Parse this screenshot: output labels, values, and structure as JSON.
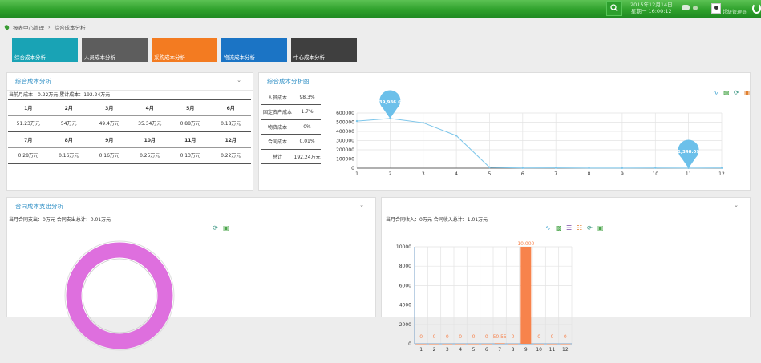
{
  "header": {
    "date": "2015年12月14日",
    "time": "星期一 16:00:12",
    "user": "超级管理员"
  },
  "breadcrumb": {
    "root": "报表中心管理",
    "current": "综合成本分析"
  },
  "tiles": [
    {
      "label": "综合成本分析",
      "color": "#19a3b5"
    },
    {
      "label": "人员成本分析",
      "color": "#5d5d5d"
    },
    {
      "label": "采购成本分析",
      "color": "#f37b21"
    },
    {
      "label": "物流成本分析",
      "color": "#1b74c5"
    },
    {
      "label": "中心成本分析",
      "color": "#3f3f3f"
    }
  ],
  "monthly": {
    "title": "综合成本分析",
    "summary": "当前月成本：0.22万元 累计成本：192.24万元",
    "row1_months": [
      "1月",
      "2月",
      "3月",
      "4月",
      "5月",
      "6月"
    ],
    "row1_values": [
      "51.23万元",
      "54万元",
      "49.4万元",
      "35.34万元",
      "0.88万元",
      "0.18万元"
    ],
    "row2_months": [
      "7月",
      "8月",
      "9月",
      "10月",
      "11月",
      "12月"
    ],
    "row2_values": [
      "0.28万元",
      "0.16万元",
      "0.16万元",
      "0.25万元",
      "0.13万元",
      "0.22万元"
    ]
  },
  "cost_chart": {
    "title": "综合成本分析图",
    "breakdown": [
      {
        "name": "人员成本",
        "pct": "98.3%"
      },
      {
        "name": "固定资产成本",
        "pct": "1.7%"
      },
      {
        "name": "物资成本",
        "pct": "0%"
      },
      {
        "name": "合同成本",
        "pct": "0.01%"
      },
      {
        "name": "总计",
        "pct": "192.24万元"
      }
    ]
  },
  "contract_expense": {
    "title": "合同成本支出分析",
    "summary": "当月合同支出：0万元 合同支出总计：0.01万元"
  },
  "contract_income": {
    "summary": "当月合同收入：0万元 合同收入总计：1.01万元"
  },
  "colors": {
    "line": "#7dc6ea",
    "bar": "#f7834c",
    "donut": "#de6fde",
    "accent": "#2c8ec4"
  },
  "chart_data": [
    {
      "type": "line",
      "x": [
        1,
        2,
        3,
        4,
        5,
        6,
        7,
        8,
        9,
        10,
        11,
        12
      ],
      "values": [
        512300,
        539986.64,
        494000,
        353400,
        8800,
        1800,
        2800,
        1600,
        1600,
        2500,
        1348.09,
        2200
      ],
      "ylim": [
        0,
        600000
      ],
      "yticks": [
        "600000",
        "500000",
        "400000",
        "300000",
        "200000",
        "100000",
        "0"
      ],
      "xticks": [
        "1",
        "2",
        "3",
        "4",
        "5",
        "6",
        "7",
        "8",
        "9",
        "10",
        "11",
        "12"
      ],
      "markers": [
        {
          "x": 2,
          "label": "539,986.64"
        },
        {
          "x": 11,
          "label": "1,348.09"
        }
      ]
    },
    {
      "type": "pie",
      "values": [
        100
      ],
      "style": "donut"
    },
    {
      "type": "bar",
      "categories": [
        "1",
        "2",
        "3",
        "4",
        "5",
        "6",
        "7",
        "8",
        "9",
        "10",
        "11",
        "12"
      ],
      "values": [
        0,
        0,
        0,
        0,
        0,
        0,
        50.55,
        0,
        10000,
        0,
        0,
        0
      ],
      "labels": [
        "0",
        "0",
        "0",
        "0",
        "0",
        "0",
        "50.55",
        "0",
        "10,000",
        "0",
        "0",
        "0"
      ],
      "ylim": [
        0,
        10000
      ],
      "yticks": [
        "10000",
        "8000",
        "6000",
        "4000",
        "2000",
        "0"
      ]
    }
  ]
}
